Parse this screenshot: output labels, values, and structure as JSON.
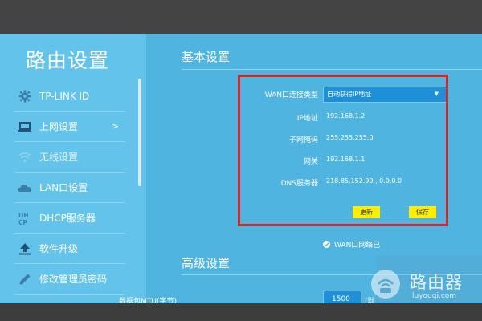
{
  "sidebar": {
    "title": "路由设置",
    "items": [
      {
        "label": "TP-LINK ID",
        "icon": "gear-icon"
      },
      {
        "label": "上网设置",
        "icon": "monitor-icon",
        "arrow": ">"
      },
      {
        "label": "无线设置",
        "icon": "wifi-icon"
      },
      {
        "label": "LAN口设置",
        "icon": "cloud-icon"
      },
      {
        "label": "DHCP服务器",
        "icon": "dhcp-icon"
      },
      {
        "label": "软件升级",
        "icon": "upload-icon"
      },
      {
        "label": "修改管理员密码",
        "icon": "pencil-icon"
      }
    ]
  },
  "basic": {
    "title": "基本设置",
    "wan_type_label": "WAN口连接类型",
    "wan_type_value": "自动获得IP地址",
    "ip_label": "IP地址",
    "ip_value": "192.168.1.2",
    "mask_label": "子网掩码",
    "mask_value": "255.255.255.0",
    "gateway_label": "网关",
    "gateway_value": "192.168.1.1",
    "dns_label": "DNS服务器",
    "dns_value": "218.85.152.99 , 0.0.0.0",
    "update_button": "更新",
    "save_button": "保存",
    "status_text": "WAN口网络已"
  },
  "advanced": {
    "title": "高级设置",
    "mtu_label": "数据包MTU(字节)",
    "mtu_value": "1500",
    "mtu_unit": "(默"
  },
  "watermark": {
    "name": "路由器",
    "url": "luyouqi.com"
  },
  "colors": {
    "page_bg": "#4fb5e0",
    "sidebar_bg": "#64c3ea",
    "input_bg": "#1e90d8",
    "button_bg": "#ffee00",
    "highlight_border": "#d8252b"
  }
}
